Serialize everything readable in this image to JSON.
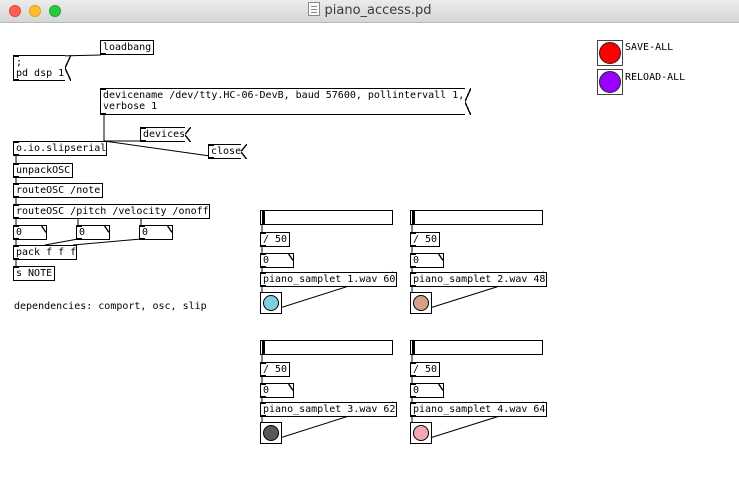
{
  "window": {
    "title": "piano_access.pd"
  },
  "colors": {
    "save_all": "#ff0000",
    "reload_all": "#9a00ff",
    "sampler_1": "#7ecfe0",
    "sampler_2": "#d4a184",
    "sampler_3": "#595959",
    "sampler_4": "#f2a7b3"
  },
  "patch": {
    "loadbang": "loadbang",
    "dsp_msg": ";\npd dsp 1",
    "devicename_msg": "devicename /dev/tty.HC-06-DevB, baud 57600, pollintervall 1,\nverbose 1",
    "devices_msg": "devices",
    "close_msg": "close",
    "slipserial": "o.io.slipserial",
    "unpack": "unpackOSC",
    "route_note": "routeOSC /note",
    "route_params": "routeOSC /pitch /velocity /onoff",
    "atoms": [
      "0",
      "0",
      "0"
    ],
    "pack": "pack f f f",
    "send": "s NOTE",
    "comment": "dependencies: comport, osc, slip",
    "save_all": "SAVE-ALL",
    "reload_all": "RELOAD-ALL"
  },
  "samplers": [
    {
      "div": "/ 50",
      "value": "0",
      "object": "piano_samplet 1.wav 60"
    },
    {
      "div": "/ 50",
      "value": "0",
      "object": "piano_samplet 2.wav 48"
    },
    {
      "div": "/ 50",
      "value": "0",
      "object": "piano_samplet 3.wav 62"
    },
    {
      "div": "/ 50",
      "value": "0",
      "object": "piano_samplet 4.wav 64"
    }
  ]
}
